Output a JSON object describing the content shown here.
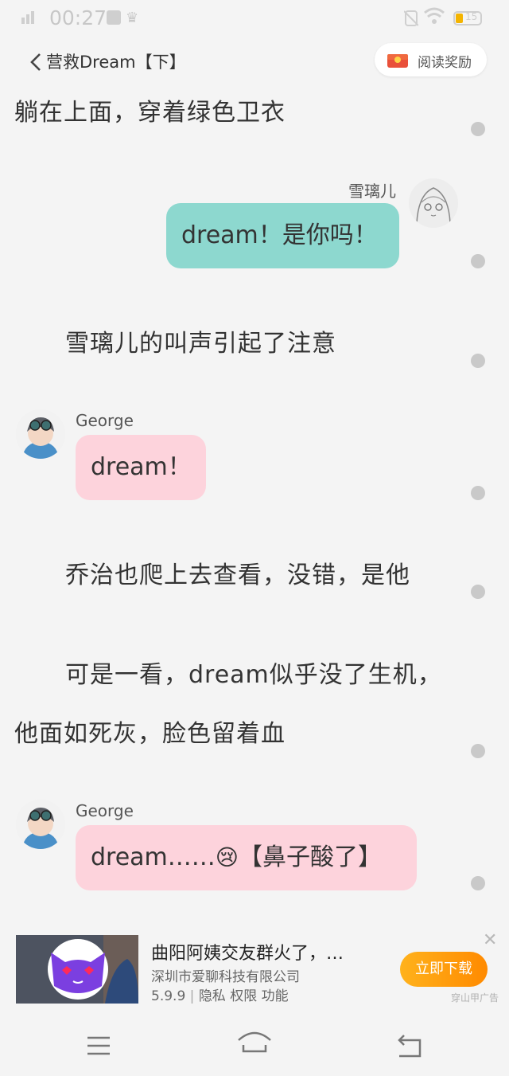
{
  "status_bar": {
    "time": "00:27",
    "battery": "15"
  },
  "header": {
    "title": "营救Dream【下】",
    "reward_label": "阅读奖励"
  },
  "story": {
    "p1": "躺在上面，穿着绿色卫衣",
    "msg1": {
      "speaker": "雪璃儿",
      "text": "dream！是你吗！"
    },
    "p2": "雪璃儿的叫声引起了注意",
    "msg2": {
      "speaker": "George",
      "text": "dream！"
    },
    "p3": "乔治也爬上去查看，没错，是他",
    "p4_line1": "可是一看，dream似乎没了生机，",
    "p4_line2": "他面如死灰，脸色留着血",
    "msg3": {
      "speaker": "George",
      "text_prefix": "dream……",
      "emoji": "😢",
      "text_suffix": "【鼻子酸了】"
    }
  },
  "ad": {
    "title": "曲阳阿姨交友群火了，…",
    "company": "深圳市爱聊科技有限公司",
    "version": "5.9.9",
    "privacy": "隐私",
    "permissions": "权限",
    "features": "功能",
    "separator": "|",
    "download_label": "立即下载",
    "close_symbol": "✕",
    "tag": "穿山甲广告"
  },
  "icons": {
    "back": "chevron-left-icon",
    "gift": "gift-icon",
    "menu": "menu-icon",
    "home": "home-icon",
    "return": "return-icon"
  },
  "colors": {
    "teal_bubble": "#8dd8cf",
    "pink_bubble": "#fdd3dc",
    "download_button": "#ff9a0e"
  }
}
